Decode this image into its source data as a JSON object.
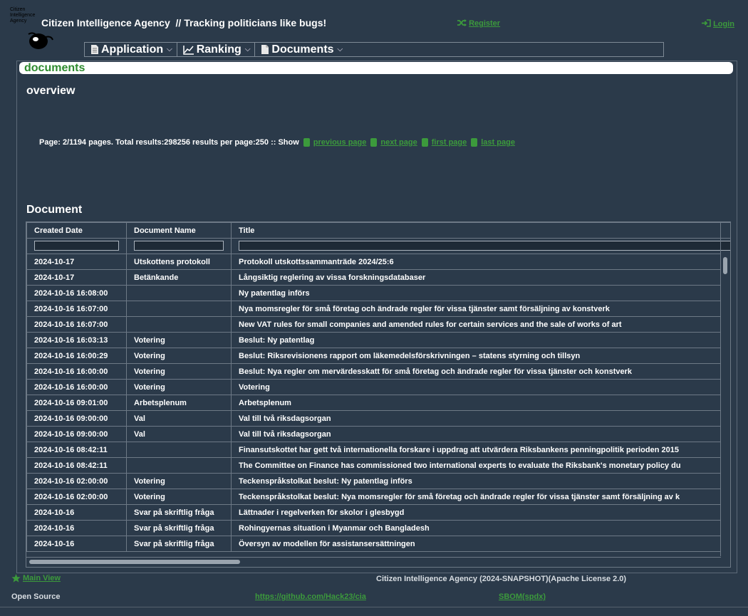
{
  "header": {
    "logo_text": [
      "Citizen",
      "Intelligence",
      "Agency"
    ],
    "app_title": "Citizen Intelligence Agency",
    "tagline": "// Tracking politicians like bugs!",
    "register_label": "Register",
    "login_label": "Login"
  },
  "menu": {
    "items": [
      {
        "label": "Application",
        "icon": "document-icon"
      },
      {
        "label": "Ranking",
        "icon": "chart-line-icon"
      },
      {
        "label": "Documents",
        "icon": "document-icon"
      }
    ]
  },
  "panel": {
    "header": "documents",
    "overview": "overview",
    "pager_text": "Page: 2/1194 pages. Total results:298256 results per page:250 :: Show",
    "pager_links": [
      "previous page",
      "next page",
      "first page",
      "last page"
    ],
    "section_title": "Document"
  },
  "grid": {
    "columns": [
      "Created Date",
      "Document Name",
      "Title"
    ],
    "rows": [
      [
        "2024-10-17",
        "Utskottens protokoll",
        "Protokoll utskottssammanträde 2024/25:6"
      ],
      [
        "2024-10-17",
        "Betänkande",
        "Långsiktig reglering av vissa forskningsdatabaser"
      ],
      [
        "2024-10-16 16:08:00",
        "",
        "Ny patentlag införs"
      ],
      [
        "2024-10-16 16:07:00",
        "",
        "Nya momsregler för små företag och ändrade regler för vissa tjänster samt försäljning av konstverk"
      ],
      [
        "2024-10-16 16:07:00",
        "",
        "New VAT rules for small companies and amended rules for certain services and the sale of works of art"
      ],
      [
        "2024-10-16 16:03:13",
        "Votering",
        "Beslut: Ny patentlag"
      ],
      [
        "2024-10-16 16:00:29",
        "Votering",
        "Beslut: Riksrevisionens rapport om läkemedelsförskrivningen – statens styrning och tillsyn"
      ],
      [
        "2024-10-16 16:00:00",
        "Votering",
        "Beslut: Nya regler om mervärdesskatt för små företag och ändrade regler för vissa tjänster och konstverk"
      ],
      [
        "2024-10-16 16:00:00",
        "Votering",
        "Votering"
      ],
      [
        "2024-10-16 09:01:00",
        "Arbetsplenum",
        "Arbetsplenum"
      ],
      [
        "2024-10-16 09:00:00",
        "Val",
        "Val till två riksdagsorgan"
      ],
      [
        "2024-10-16 09:00:00",
        "Val",
        "Val till två riksdagsorgan"
      ],
      [
        "2024-10-16 08:42:11",
        "",
        "Finansutskottet har gett två internationella forskare i uppdrag att utvärdera Riksbankens penningpolitik perioden 2015"
      ],
      [
        "2024-10-16 08:42:11",
        "",
        "The Committee on Finance has commissioned two international experts to evaluate the Riksbank's monetary policy du"
      ],
      [
        "2024-10-16 02:00:00",
        "Votering",
        "Teckenspråkstolkat beslut: Ny patentlag införs"
      ],
      [
        "2024-10-16 02:00:00",
        "Votering",
        "Teckenspråkstolkat beslut: Nya momsregler för små företag och ändrade regler för vissa tjänster samt försäljning av k"
      ],
      [
        "2024-10-16",
        "Svar på skriftlig fråga",
        "Lättnader i regelverken för skolor i glesbygd"
      ],
      [
        "2024-10-16",
        "Svar på skriftlig fråga",
        "Rohingyernas situation i Myanmar och Bangladesh"
      ],
      [
        "2024-10-16",
        "Svar på skriftlig fråga",
        "Översyn av modellen för assistansersättningen"
      ]
    ]
  },
  "footer": {
    "main_view": "Main View",
    "version": "Citizen Intelligence Agency (2024-SNAPSHOT)(Apache License 2.0)",
    "open_source": "Open Source",
    "github": "https://github.com/Hack23/cia",
    "sbom": "SBOM(spdx)"
  },
  "colors": {
    "background": "#2b3a4a",
    "link_green": "#3c9a3c",
    "header_green": "#2e8b2e"
  }
}
